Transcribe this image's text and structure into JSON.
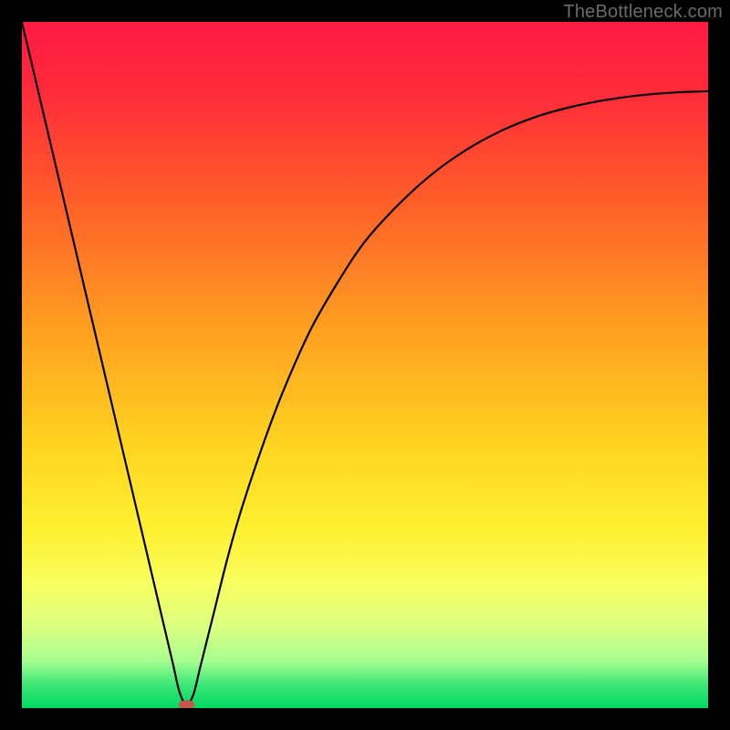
{
  "watermark": "TheBottleneck.com",
  "chart_data": {
    "type": "line",
    "title": "",
    "xlabel": "",
    "ylabel": "",
    "xlim": [
      0,
      100
    ],
    "ylim": [
      0,
      100
    ],
    "grid": false,
    "legend": false,
    "gradient_stops": [
      {
        "offset": 0.0,
        "color": "#ff1a44"
      },
      {
        "offset": 0.1,
        "color": "#ff2a3a"
      },
      {
        "offset": 0.25,
        "color": "#ff5a2a"
      },
      {
        "offset": 0.45,
        "color": "#ffa020"
      },
      {
        "offset": 0.62,
        "color": "#ffd520"
      },
      {
        "offset": 0.74,
        "color": "#fff030"
      },
      {
        "offset": 0.82,
        "color": "#f8ff60"
      },
      {
        "offset": 0.88,
        "color": "#dcff80"
      },
      {
        "offset": 0.93,
        "color": "#a8ff90"
      },
      {
        "offset": 0.965,
        "color": "#40e878"
      },
      {
        "offset": 1.0,
        "color": "#00d860"
      }
    ],
    "series": [
      {
        "name": "bottleneck-curve",
        "x": [
          0,
          2,
          4,
          6,
          8,
          10,
          12,
          14,
          16,
          18,
          20,
          21,
          22,
          23,
          24,
          25,
          26,
          28,
          30,
          32,
          35,
          38,
          42,
          46,
          50,
          55,
          60,
          65,
          70,
          75,
          80,
          85,
          90,
          95,
          100
        ],
        "y": [
          100,
          91.5,
          83,
          74.5,
          66,
          57.5,
          49,
          40.5,
          32,
          23.5,
          15,
          10.75,
          6.5,
          2.25,
          0.5,
          2,
          6,
          14,
          22,
          29,
          38,
          46,
          55,
          62,
          68,
          73.5,
          78,
          81.5,
          84.2,
          86.2,
          87.6,
          88.6,
          89.3,
          89.7,
          89.9
        ]
      }
    ],
    "marker": {
      "name": "optimal-point",
      "x": 24,
      "y": 0.5,
      "color": "#c7554f",
      "rx": 9,
      "ry": 5
    }
  }
}
